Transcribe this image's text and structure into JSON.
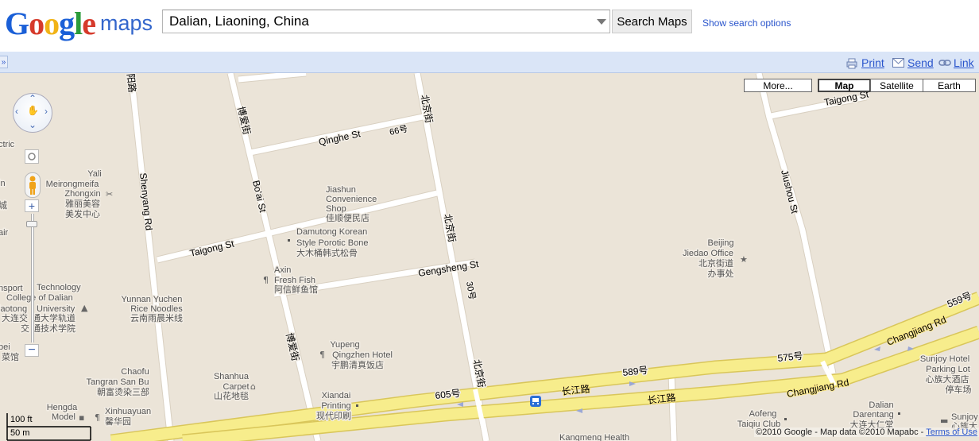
{
  "header": {
    "logo_brand": "Google",
    "logo_product": "maps",
    "search_value": "Dalian, Liaoning, China",
    "search_button": "Search Maps",
    "search_options": "Show search options"
  },
  "toolbar": {
    "collapse_label": "»",
    "print": "Print",
    "send": "Send",
    "link": "Link"
  },
  "map_type": {
    "more": "More...",
    "map": "Map",
    "satellite": "Satellite",
    "earth": "Earth",
    "selected": "Map"
  },
  "scale": {
    "feet": "100 ft",
    "meters": "50 m"
  },
  "copyright": {
    "text": "©2010 Google - Map data ©2010 Mapabc - ",
    "terms": "Terms of Use"
  },
  "roads": {
    "qinghe": "Qinghe St",
    "taigong": "Taigong St",
    "taigong_ne": "Taigong St",
    "gengsheng": "Gengsheng St",
    "bo_ai": "Bo'ai St",
    "bo_ai_cn_1": "博爱街",
    "bo_ai_cn_2": "博爱街",
    "beijing_cn_1": "北京街",
    "beijing_cn_2": "北京街",
    "beijing_cn_3": "北京街",
    "shenyang": "Shenyang Rd",
    "shenyang_cn": "阳路",
    "jiushou": "Jiushou St",
    "changjiang_1": "Changjiang Rd",
    "changjiang_2": "Changjiang Rd",
    "changjiang_cn_1": "长江路",
    "changjiang_cn_2": "长江路",
    "no66": "66号",
    "no30": "30号",
    "no605": "605号",
    "no589": "589号",
    "no575": "575号",
    "no559": "559号"
  },
  "pois": {
    "left_edge": [
      "ctric",
      "in",
      "城",
      "air",
      "nsport",
      "iaotong",
      "大连交",
      "交",
      "bei",
      "菜馆"
    ],
    "yali": [
      "Yali",
      "Meirongmeifa",
      "Zhongxin",
      "雅丽美容",
      "美发中心"
    ],
    "jiashun": [
      "Jiashun",
      "Convenience",
      "Shop",
      "佳顺便民店"
    ],
    "damutong": [
      "Damutong Korean",
      "Style Porotic Bone",
      "大木桶韩式松骨"
    ],
    "axin": [
      "Axin",
      "Fresh Fish",
      "阿信鲜鱼馆"
    ],
    "beijing_jiedao": [
      "Beijing",
      "Jiedao Office",
      "北京街道",
      "办事处"
    ],
    "transport_college": [
      "Technology",
      "College of Dalian",
      "University",
      "通大学轨道",
      "通技术学院"
    ],
    "yunnan": [
      "Yunnan Yuchen",
      "Rice Noodles",
      "云南雨晨米线"
    ],
    "yupeng": [
      "Yupeng",
      "Qingzhen Hotel",
      "宇鹏清真饭店"
    ],
    "chaofu": [
      "Chaofu",
      "Tangran San Bu",
      "朝富烫染三部"
    ],
    "shanhua": [
      "Shanhua",
      "Carpet",
      "山花地毯"
    ],
    "xiandai": [
      "Xiandai",
      "Printing",
      "现代印刷"
    ],
    "hengda": [
      "Hengda",
      "Model"
    ],
    "xinhuayuan": [
      "Xinhuayuan",
      "馨华园"
    ],
    "sunjoy_parking": [
      "Sunjoy Hotel",
      "Parking Lot",
      "心族大酒店",
      "停车场"
    ],
    "dalian_darentang": [
      "Dalian",
      "Darentang",
      "大连大仁堂"
    ],
    "aofeng": [
      "Aofeng",
      "Taiqiu Club"
    ],
    "sunjoy": [
      "Sunjoy",
      "心族大"
    ],
    "kangmeng": [
      "Kangmeng Health"
    ]
  },
  "colors": {
    "land": "#ebe4d8",
    "road": "#ffffff",
    "road_edge": "#d6cdbd",
    "arterial": "#f7ed8c",
    "arterial_edge": "#d9c65a",
    "toolbar": "#dae5f7",
    "link": "#2a55cc"
  }
}
